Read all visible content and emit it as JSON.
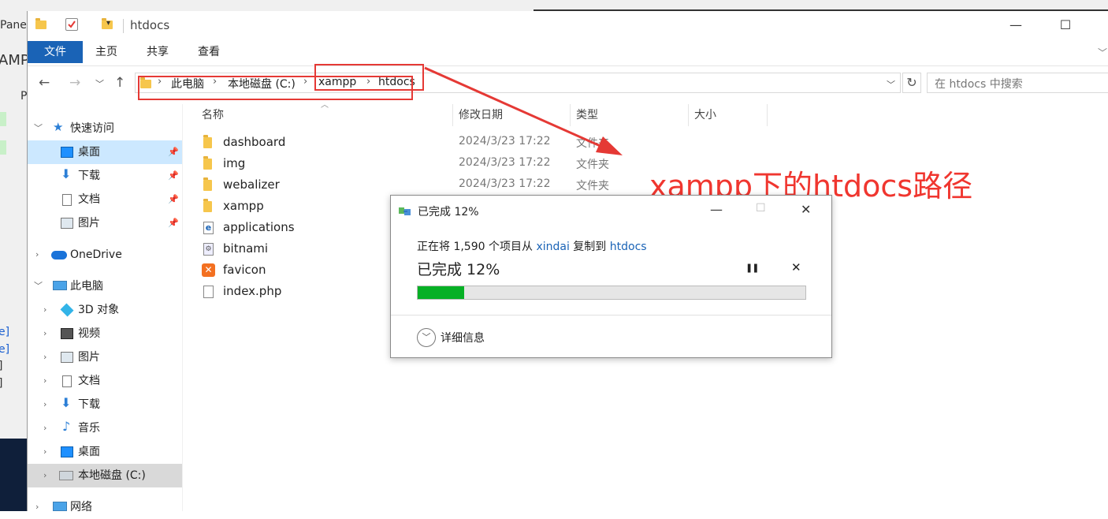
{
  "background_window": {
    "texts": [
      "Pane",
      "AMP",
      "P",
      "e]",
      "e]",
      "]",
      "]"
    ]
  },
  "window": {
    "title": "htdocs",
    "controls": {
      "minimize": "—",
      "maximize": "☐",
      "close": "✕"
    }
  },
  "ribbon": {
    "tabs": [
      "文件",
      "主页",
      "共享",
      "查看"
    ]
  },
  "address": {
    "crumbs": [
      "此电脑",
      "本地磁盘 (C:)",
      "xampp",
      "htdocs"
    ],
    "search_placeholder": "在 htdocs 中搜索"
  },
  "nav": {
    "quick_access": "快速访问",
    "quick_items": [
      "桌面",
      "下载",
      "文档",
      "图片"
    ],
    "onedrive": "OneDrive",
    "this_pc": "此电脑",
    "pc_items": [
      "3D 对象",
      "视频",
      "图片",
      "文档",
      "下载",
      "音乐",
      "桌面",
      "本地磁盘 (C:)"
    ],
    "network": "网络"
  },
  "columns": {
    "name": "名称",
    "date": "修改日期",
    "type": "类型",
    "size": "大小"
  },
  "files": [
    {
      "name": "dashboard",
      "date": "2024/3/23 17:22",
      "type": "文件夹"
    },
    {
      "name": "img",
      "date": "2024/3/23 17:22",
      "type": "文件夹"
    },
    {
      "name": "webalizer",
      "date": "2024/3/23 17:22",
      "type": "文件夹"
    },
    {
      "name": "xampp",
      "date": "",
      "type": ""
    },
    {
      "name": "applications",
      "date": "",
      "type": ""
    },
    {
      "name": "bitnami",
      "date": "",
      "type": ""
    },
    {
      "name": "favicon",
      "date": "",
      "type": ""
    },
    {
      "name": "index.php",
      "date": "",
      "type": ""
    }
  ],
  "annotation": "xampp下的htdocs路径",
  "dialog": {
    "title": "已完成 12%",
    "desc_prefix": "正在将 1,590 个项目从 ",
    "source": "xindai",
    "desc_middle": " 复制到 ",
    "target": "htdocs",
    "big_status": "已完成 12%",
    "progress": 0.12,
    "details": "详细信息",
    "pause": "❚❚",
    "cancel": "✕"
  },
  "colors": {
    "accent": "#1a63b6",
    "annotation_red": "#f0362f",
    "progress_green": "#06b025"
  }
}
